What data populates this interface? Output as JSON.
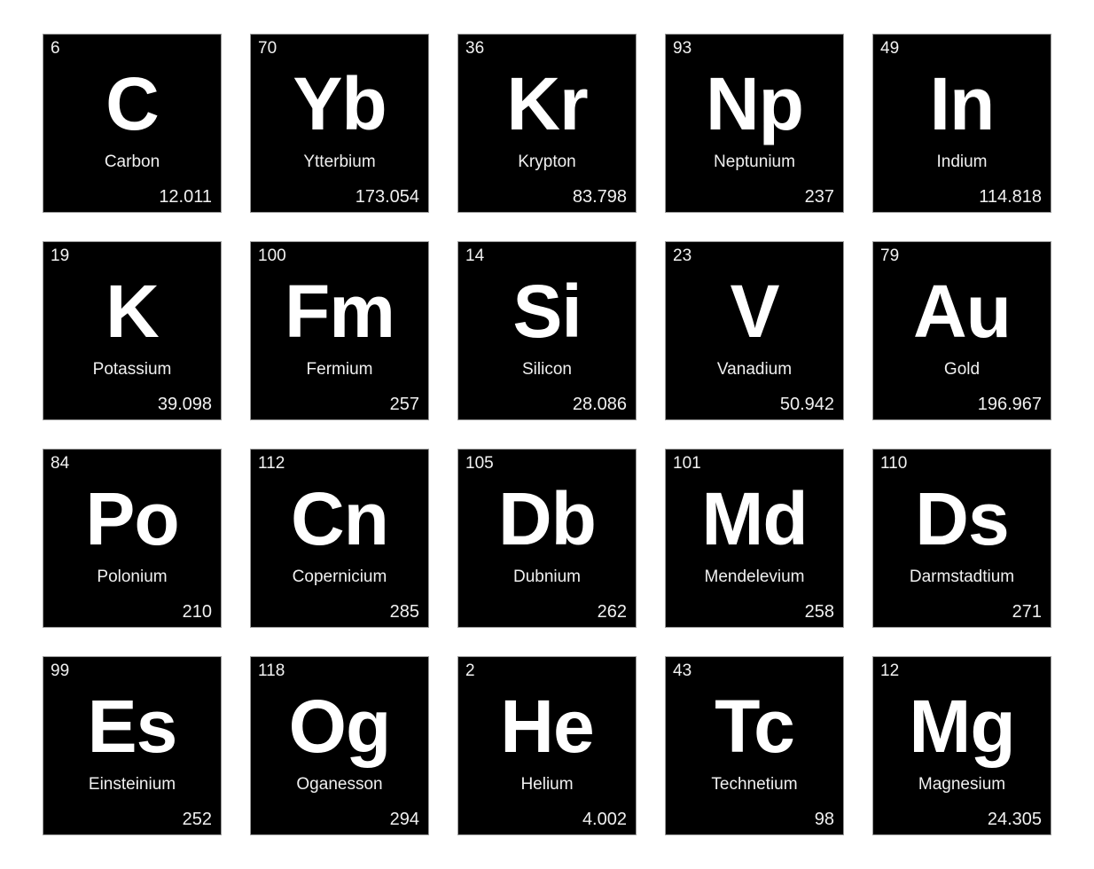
{
  "elements": [
    {
      "number": "6",
      "symbol": "C",
      "name": "Carbon",
      "mass": "12.011"
    },
    {
      "number": "70",
      "symbol": "Yb",
      "name": "Ytterbium",
      "mass": "173.054"
    },
    {
      "number": "36",
      "symbol": "Kr",
      "name": "Krypton",
      "mass": "83.798"
    },
    {
      "number": "93",
      "symbol": "Np",
      "name": "Neptunium",
      "mass": "237"
    },
    {
      "number": "49",
      "symbol": "In",
      "name": "Indium",
      "mass": "114.818"
    },
    {
      "number": "19",
      "symbol": "K",
      "name": "Potassium",
      "mass": "39.098"
    },
    {
      "number": "100",
      "symbol": "Fm",
      "name": "Fermium",
      "mass": "257"
    },
    {
      "number": "14",
      "symbol": "Si",
      "name": "Silicon",
      "mass": "28.086"
    },
    {
      "number": "23",
      "symbol": "V",
      "name": "Vanadium",
      "mass": "50.942"
    },
    {
      "number": "79",
      "symbol": "Au",
      "name": "Gold",
      "mass": "196.967"
    },
    {
      "number": "84",
      "symbol": "Po",
      "name": "Polonium",
      "mass": "210"
    },
    {
      "number": "112",
      "symbol": "Cn",
      "name": "Copernicium",
      "mass": "285"
    },
    {
      "number": "105",
      "symbol": "Db",
      "name": "Dubnium",
      "mass": "262"
    },
    {
      "number": "101",
      "symbol": "Md",
      "name": "Mendelevium",
      "mass": "258"
    },
    {
      "number": "110",
      "symbol": "Ds",
      "name": "Darmstadtium",
      "mass": "271"
    },
    {
      "number": "99",
      "symbol": "Es",
      "name": "Einsteinium",
      "mass": "252"
    },
    {
      "number": "118",
      "symbol": "Og",
      "name": "Oganesson",
      "mass": "294"
    },
    {
      "number": "2",
      "symbol": "He",
      "name": "Helium",
      "mass": "4.002"
    },
    {
      "number": "43",
      "symbol": "Tc",
      "name": "Technetium",
      "mass": "98"
    },
    {
      "number": "12",
      "symbol": "Mg",
      "name": "Magnesium",
      "mass": "24.305"
    }
  ],
  "colors": {
    "tile_bg": "#000000",
    "text": "#ffffff",
    "page_bg": "#ffffff"
  }
}
